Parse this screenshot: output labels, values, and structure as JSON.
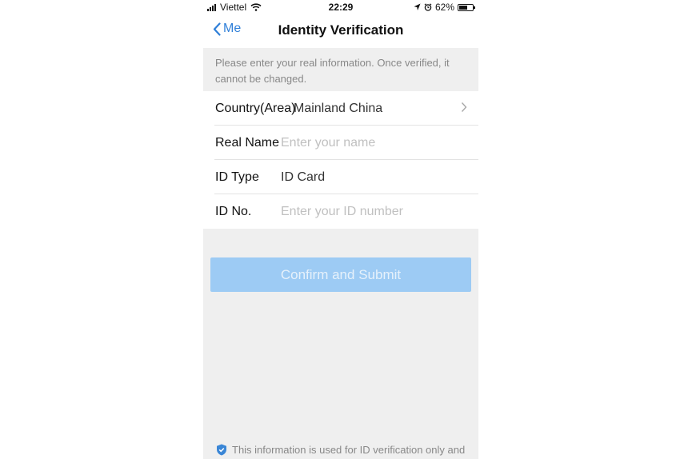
{
  "status_bar": {
    "carrier": "Viettel",
    "time": "22:29",
    "battery_percent": "62%",
    "battery_level": 0.62,
    "icons": [
      "signal-icon",
      "wifi-icon",
      "location-icon",
      "alarm-icon",
      "battery-icon"
    ]
  },
  "nav": {
    "back_label": "Me",
    "title": "Identity Verification"
  },
  "notice": {
    "text": "Please enter your real information. Once verified, it cannot be changed."
  },
  "form": {
    "country": {
      "label": "Country(Area)",
      "value": "Mainland China"
    },
    "real_name": {
      "label": "Real Name",
      "placeholder": "Enter your name",
      "value": ""
    },
    "id_type": {
      "label": "ID Type",
      "value": "ID Card"
    },
    "id_no": {
      "label": "ID No.",
      "placeholder": "Enter your ID number",
      "value": ""
    }
  },
  "submit_label": "Confirm and Submit",
  "footer": {
    "text": "This information is used for ID verification only and"
  },
  "colors": {
    "accent": "#2f7fd8",
    "button_disabled": "#9dcbf4",
    "background": "#efefef",
    "shield": "#3a86d6"
  }
}
